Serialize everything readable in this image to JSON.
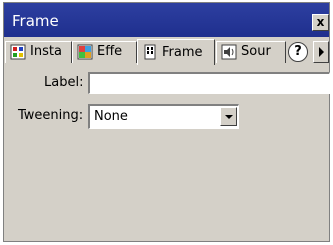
{
  "window": {
    "title": "Frame",
    "close_glyph": "x"
  },
  "tabs": [
    {
      "label": "Insta",
      "icon": "instance-icon",
      "active": false
    },
    {
      "label": "Effe",
      "icon": "effect-icon",
      "active": false
    },
    {
      "label": "Frame",
      "icon": "frame-icon",
      "active": true
    },
    {
      "label": "Sour",
      "icon": "sound-icon",
      "active": false
    }
  ],
  "help_glyph": "?",
  "form": {
    "label_caption": "Label:",
    "label_value": "",
    "tweening_caption": "Tweening:",
    "tweening_value": "None"
  },
  "colors": {
    "titlebar": "#1f2f8e",
    "panel": "#d4d0c8"
  }
}
